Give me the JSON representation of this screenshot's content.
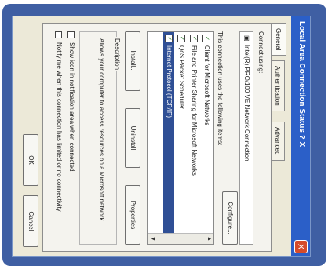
{
  "window": {
    "title": "Local Area Connection Status  ?  X",
    "close_glyph": "X"
  },
  "tabs": [
    {
      "label": "General"
    },
    {
      "label": "Authentication"
    },
    {
      "label": "Advanced"
    }
  ],
  "panel": {
    "connect_using_label": "Connect using:",
    "device_name": "Intel(R) PRO/100 VE Network Connection",
    "configure_button": "Configure...",
    "items_label": "This connection uses the following items:",
    "items": [
      {
        "label": "Client for Microsoft Networks",
        "checked": true,
        "selected": false
      },
      {
        "label": "File and Printer Sharing for Microsoft Networks",
        "checked": true,
        "selected": false
      },
      {
        "label": "QoS Packet Scheduler",
        "checked": true,
        "selected": false
      },
      {
        "label": "Internet Protocol (TCP/IP)",
        "checked": true,
        "selected": true
      }
    ],
    "scroll_up": "▲",
    "scroll_down": "▼",
    "install_button": "Install...",
    "uninstall_button": "Uninstall",
    "properties_button": "Properties",
    "description_label": "Description",
    "description_text": "Allows your computer to access resources on a Microsoft network.",
    "show_icon_label": "Show icon in notification area when connected",
    "notify_label": "Notify me when this connection has limited or no connectivity"
  },
  "footer": {
    "ok_button": "OK",
    "cancel_button": "Cancel"
  },
  "colors": {
    "frame_blue": "#3f5fa3",
    "titlebar_blue": "#2b5fc8",
    "selection_blue": "#2f4f95"
  }
}
